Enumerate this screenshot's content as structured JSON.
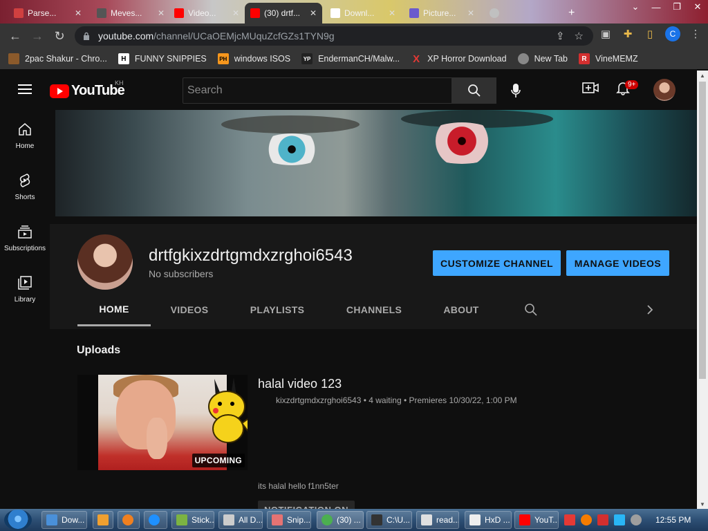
{
  "browser": {
    "tabs": [
      {
        "title": "Parse...",
        "color": "#d04040"
      },
      {
        "title": "Meves...",
        "color": "#555555"
      },
      {
        "title": "Video...",
        "color": "#ff0000"
      },
      {
        "title": "(30) drtf...",
        "color": "#ff0000"
      },
      {
        "title": "Downl...",
        "color": "#ffffff"
      },
      {
        "title": "Picture...",
        "color": "#6a5acd"
      }
    ],
    "url_host": "youtube.com",
    "url_path": "/channel/UCaOEMjcMUquZcfGZs1TYN9g",
    "profile_initial": "C",
    "bookmarks": [
      {
        "label": "2pac Shakur - Chro...",
        "icon": "image-icon",
        "color": "#8b5a2b",
        "glyph": ""
      },
      {
        "label": "FUNNY SNIPPIES",
        "icon": "h-icon",
        "color": "#ffffff",
        "glyph": "H"
      },
      {
        "label": "windows ISOS",
        "icon": "ph-icon",
        "color": "#f7971d",
        "glyph": "PH"
      },
      {
        "label": "EndermanCH/Malw...",
        "icon": "yp-icon",
        "color": "#222222",
        "glyph": "YP"
      },
      {
        "label": "XP Horror Download",
        "icon": "x-icon",
        "color": "#cc0000",
        "glyph": "X"
      },
      {
        "label": "New Tab",
        "icon": "globe-icon",
        "color": "#888888",
        "glyph": ""
      },
      {
        "label": "VineMEMZ",
        "icon": "r-icon",
        "color": "#d32f2f",
        "glyph": "R"
      }
    ]
  },
  "youtube": {
    "logo_text": "YouTube",
    "country_code": "KH",
    "search_placeholder": "Search",
    "notification_count": "9+",
    "guide": [
      {
        "label": "Home",
        "icon": "home-icon"
      },
      {
        "label": "Shorts",
        "icon": "shorts-icon"
      },
      {
        "label": "Subscriptions",
        "icon": "subscriptions-icon"
      },
      {
        "label": "Library",
        "icon": "library-icon"
      }
    ],
    "channel": {
      "name": "drtfgkixzdrtgmdxzrghoi6543",
      "subscribers": "No subscribers",
      "customize_label": "CUSTOMIZE CHANNEL",
      "manage_label": "MANAGE VIDEOS"
    },
    "tabs": [
      "HOME",
      "VIDEOS",
      "PLAYLISTS",
      "CHANNELS",
      "ABOUT"
    ],
    "active_tab": "HOME",
    "section_title": "Uploads",
    "video": {
      "title": "halal video 123",
      "meta": "kixzdrtgmdxzrghoi6543 • 4 waiting • Premieres 10/30/22, 1:00 PM",
      "description": "its halal hello f1nn5ter",
      "badge": "UPCOMING",
      "notify_label": "NOTIFICATION ON"
    }
  },
  "taskbar": {
    "items": [
      {
        "label": "Dow...",
        "color": "#4a90d9"
      },
      {
        "label": "",
        "color": "#f0a030"
      },
      {
        "label": "",
        "color": "#f08020"
      },
      {
        "label": "",
        "color": "#1e90ff"
      },
      {
        "label": "Stick...",
        "color": "#7cb342"
      },
      {
        "label": "All D...",
        "color": "#cccccc"
      },
      {
        "label": "Snip...",
        "color": "#e57373"
      },
      {
        "label": "(30) ...",
        "color": "#4caf50"
      },
      {
        "label": "C:\\U...",
        "color": "#333333"
      },
      {
        "label": "read...",
        "color": "#e0e0e0"
      },
      {
        "label": "HxD ...",
        "color": "#eeeeee"
      },
      {
        "label": "YouT...",
        "color": "#ff0000"
      }
    ],
    "clock": "12:55 PM"
  },
  "colors": {
    "accent_blue": "#3ea6ff",
    "youtube_red": "#ff0000",
    "bg": "#0f0f0f"
  }
}
